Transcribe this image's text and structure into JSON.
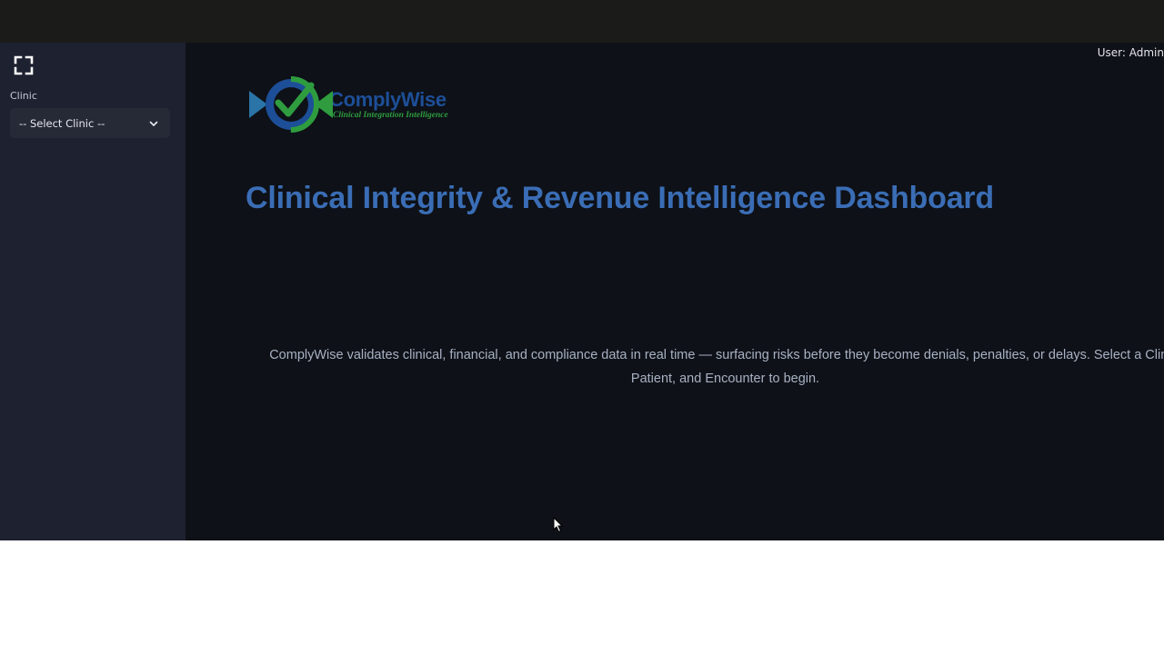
{
  "sidebar": {
    "fullscreen_icon": "fullscreen-icon",
    "clinic_label": "Clinic",
    "clinic_select_value": "-- Select Clinic --",
    "chevron_icon": "chevron-down-icon"
  },
  "header": {
    "user_label": "User: Admin"
  },
  "logo": {
    "name": "ComplyWise",
    "tagline": "Clinical Integration Intelligence"
  },
  "main": {
    "title": "Clinical Integrity & Revenue Intelligence Dashboard",
    "description": "ComplyWise validates clinical, financial, and compliance data in real time — surfacing risks before they become denials, penalties, or delays. Select a Clinic, Patient, and Encounter to begin."
  },
  "colors": {
    "topbar": "#1b1b1a",
    "sidebar": "#1e2130",
    "main_bg": "#0e1117",
    "title": "#3a6db5",
    "logo_blue": "#1d4f98",
    "logo_green": "#2e9c3f"
  }
}
